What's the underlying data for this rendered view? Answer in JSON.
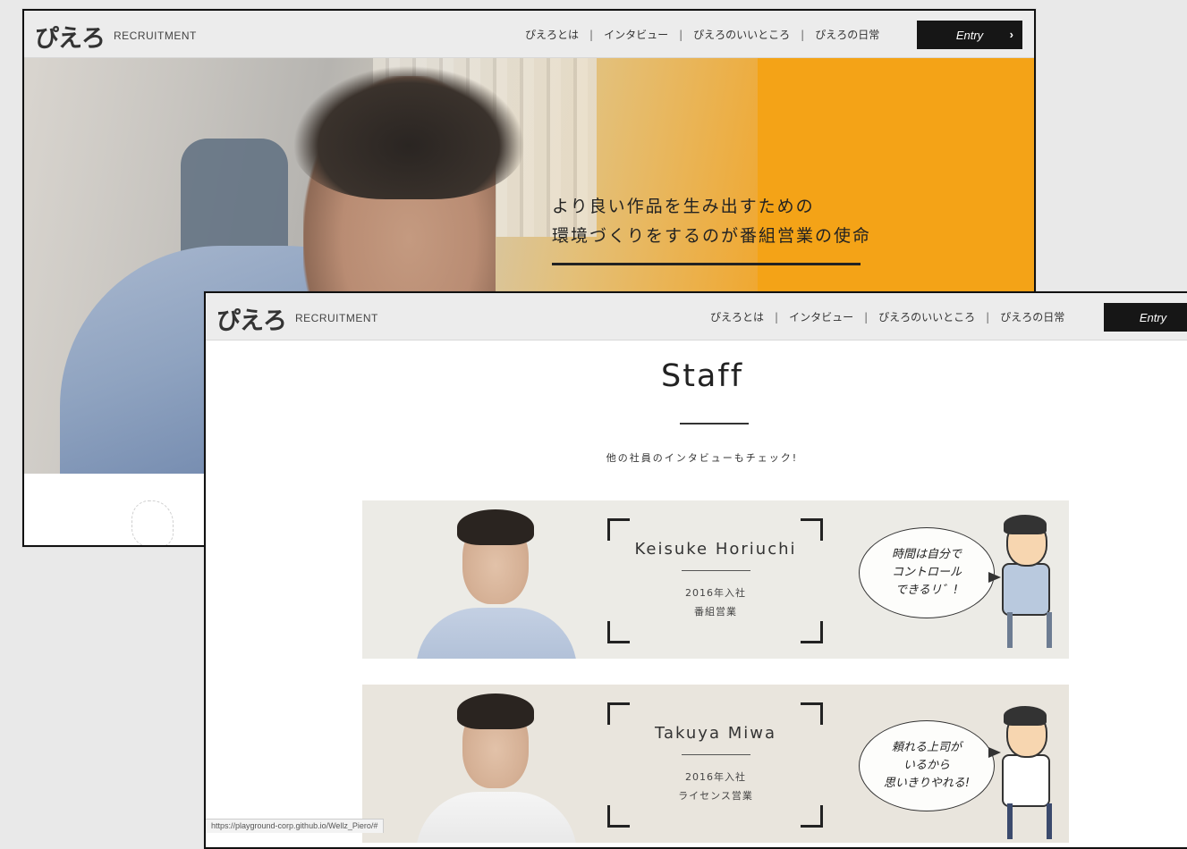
{
  "back_window": {
    "logo": "ぴえろ",
    "logo_sub": "RECRUITMENT",
    "nav": [
      "ぴえろとは",
      "インタビュー",
      "ぴえろのいいところ",
      "ぴえろの日常"
    ],
    "entry_label": "Entry",
    "hero_line1": "より良い作品を生み出すための",
    "hero_line2": "環境づくりをするのが番組営業の使命"
  },
  "front_window": {
    "logo": "ぴえろ",
    "logo_sub": "RECRUITMENT",
    "nav": [
      "ぴえろとは",
      "インタビュー",
      "ぴえろのいいところ",
      "ぴえろの日常"
    ],
    "entry_label": "Entry",
    "section_title": "Staff",
    "section_subtitle": "他の社員のインタビューもチェック!",
    "staff": [
      {
        "name": "Keisuke Horiuchi",
        "year": "2016年入社",
        "dept": "番組営業",
        "quote_lines": [
          "時間は自分で",
          "コントロール",
          "できるリ゛!"
        ]
      },
      {
        "name": "Takuya Miwa",
        "year": "2016年入社",
        "dept": "ライセンス営業",
        "quote_lines": [
          "頼れる上司が",
          "いるから",
          "思いきりやれる!"
        ]
      }
    ],
    "status_url": "https://playground-corp.github.io/Wellz_Piero/#"
  },
  "colors": {
    "hero_orange": "#f4a317",
    "entry_bg": "#161616",
    "page_bg": "#e9e9e9"
  }
}
